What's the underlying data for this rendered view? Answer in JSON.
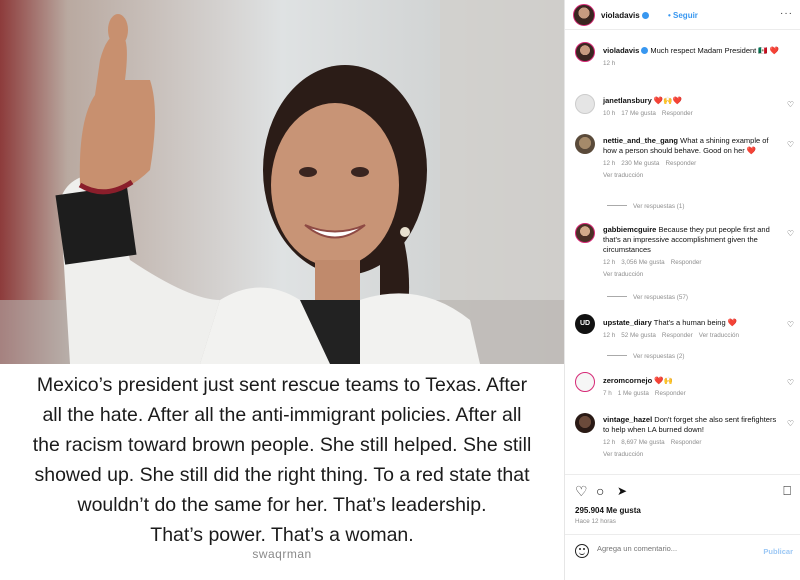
{
  "post": {
    "caption_lines": [
      "Mexico’s president just sent rescue teams to Texas. After",
      "all the hate. After all the anti-immigrant policies. After all",
      "the racism toward brown people. She still helped. She still",
      "showed up. She still did the right thing. To a red state that",
      "wouldn’t do the same for her. That’s leadership.",
      "That’s power. That’s a woman."
    ],
    "watermark": "swaqrman"
  },
  "header": {
    "username": "violadavis",
    "follow": "• Seguir",
    "more": "···"
  },
  "caption_comment": {
    "username": "violadavis",
    "text": "Much respect Madam President 🇲🇽 ❤️",
    "time": "12 h"
  },
  "comments": [
    {
      "username": "janetlansbury",
      "text": "❤️🙌❤️",
      "time": "10 h",
      "likes": "17 Me gusta",
      "reply": "Responder"
    },
    {
      "username": "nettie_and_the_gang",
      "text": "What a shining example of how a person should behave. Good on her ❤️",
      "time": "12 h",
      "likes": "230 Me gusta",
      "reply": "Responder",
      "translate": "Ver traducción",
      "replies": "Ver respuestas (1)"
    },
    {
      "username": "gabbiemcguire",
      "text": "Because they put people first and that's an impressive accomplishment given the circumstances",
      "time": "12 h",
      "likes": "3,056 Me gusta",
      "reply": "Responder",
      "translate": "Ver traducción",
      "replies": "Ver respuestas (57)"
    },
    {
      "username": "upstate_diary",
      "text": "That's a human being ❤️",
      "time": "12 h",
      "likes": "52 Me gusta",
      "reply": "Responder",
      "translate": "Ver traducción",
      "replies": "Ver respuestas (2)"
    },
    {
      "username": "zeromcornejo",
      "text": "❤️🙌",
      "time": "7 h",
      "likes": "1 Me gusta",
      "reply": "Responder"
    },
    {
      "username": "vintage_hazel",
      "text": "Don't forget she also sent firefighters to help when LA burned down!",
      "time": "12 h",
      "likes": "8,697 Me gusta",
      "reply": "Responder",
      "translate": "Ver traducción"
    }
  ],
  "footer": {
    "likes": "295.904 Me gusta",
    "time": "Hace 12 horas",
    "add_comment_placeholder": "Agrega un comentario...",
    "publish": "Publicar"
  },
  "icons": {
    "like": "heart-icon",
    "comment": "comment-icon",
    "share": "share-icon",
    "save": "bookmark-icon",
    "emoji": "emoji-icon"
  },
  "colors": {
    "link": "#3897f0",
    "verified": "#3897f0",
    "muted": "#8e8e8e"
  }
}
